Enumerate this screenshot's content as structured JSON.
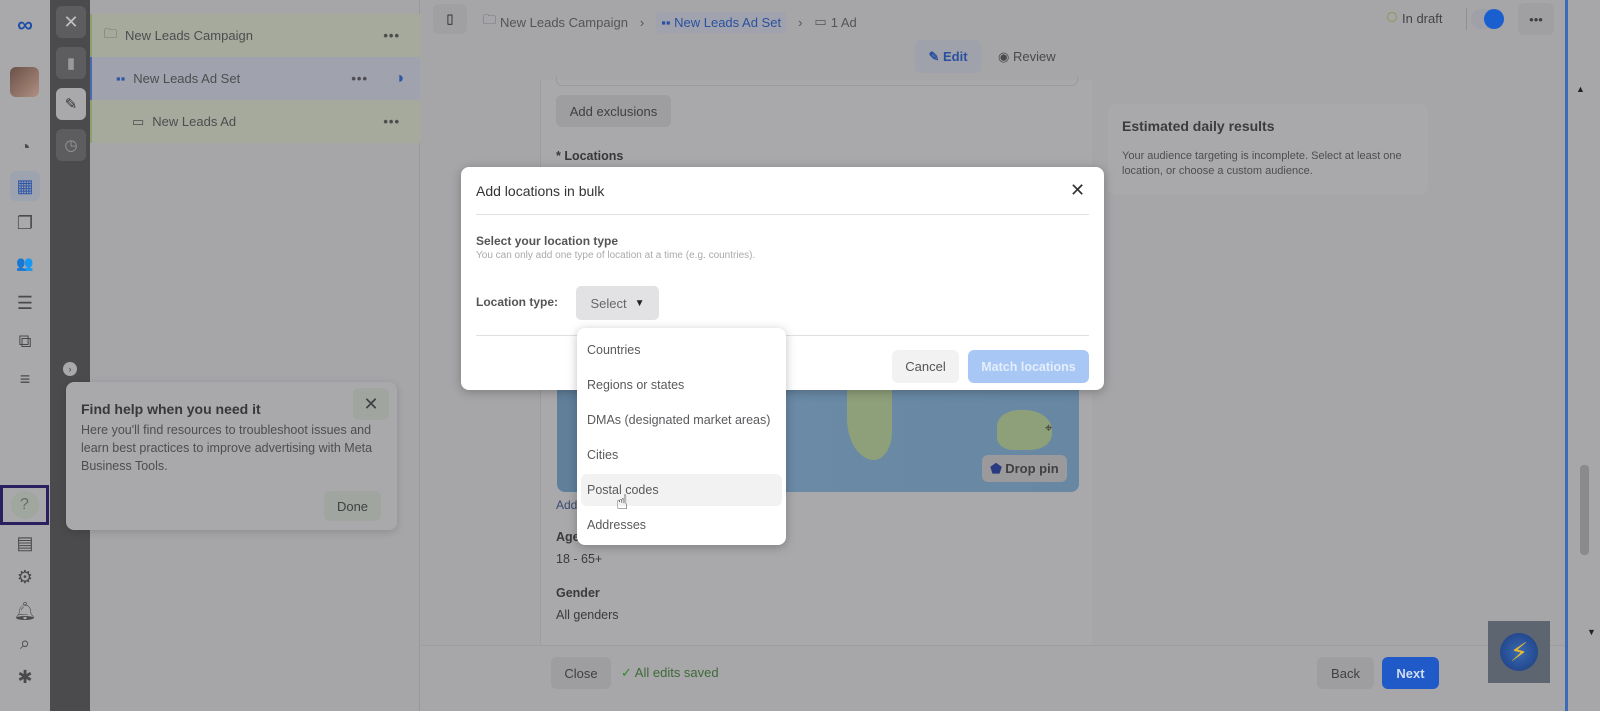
{
  "leftnav": {
    "icons": [
      "meta-logo-icon",
      "avatar",
      "dashboard-icon",
      "campaigns-table-icon",
      "pages-icon",
      "audiences-icon",
      "billing-icon",
      "catalog-icon",
      "menu-icon",
      "help-icon",
      "news-icon",
      "settings-icon",
      "notifications-icon",
      "search-icon",
      "bug-icon"
    ],
    "help_label": "?"
  },
  "tree": {
    "items": [
      {
        "label": "New Leads Campaign",
        "icon": "folder-icon"
      },
      {
        "label": "New Leads Ad Set",
        "icon": "grid-icon"
      },
      {
        "label": "New Leads Ad",
        "icon": "ad-icon"
      }
    ],
    "more": "•••"
  },
  "header": {
    "breadcrumb": [
      "New Leads Campaign",
      "New Leads Ad Set",
      "1 Ad"
    ],
    "status": "In draft",
    "more": "•••",
    "edit": "Edit",
    "review": "Review",
    "toggle_on": true,
    "accent": "#1a5fd0"
  },
  "content": {
    "add_exclusions": "Add exclusions",
    "locations_label": "* Locations",
    "drop_pin": "Drop pin",
    "add_link": "Add",
    "age_label": "Age",
    "age_value": "18 - 65+",
    "gender_label": "Gender",
    "gender_value": "All genders"
  },
  "estimate": {
    "title": "Estimated daily results",
    "text": "Your audience targeting is incomplete. Select at least one location, or choose a custom audience."
  },
  "modal": {
    "title": "Add locations in bulk",
    "section_title": "Select your location type",
    "section_hint": "You can only add one type of location at a time (e.g. countries).",
    "type_label": "Location type:",
    "select_value": "Select",
    "cancel": "Cancel",
    "match": "Match locations"
  },
  "dropdown": {
    "options": [
      "Countries",
      "Regions or states",
      "DMAs (designated market areas)",
      "Cities",
      "Postal codes",
      "Addresses"
    ],
    "hovered": "Postal codes"
  },
  "help": {
    "title": "Find help when you need it",
    "text": "Here you'll find resources to troubleshoot issues and learn best practices to improve advertising with Meta Business Tools.",
    "done": "Done"
  },
  "footer": {
    "close": "Close",
    "saved": "All edits saved",
    "back": "Back",
    "next": "Next"
  }
}
